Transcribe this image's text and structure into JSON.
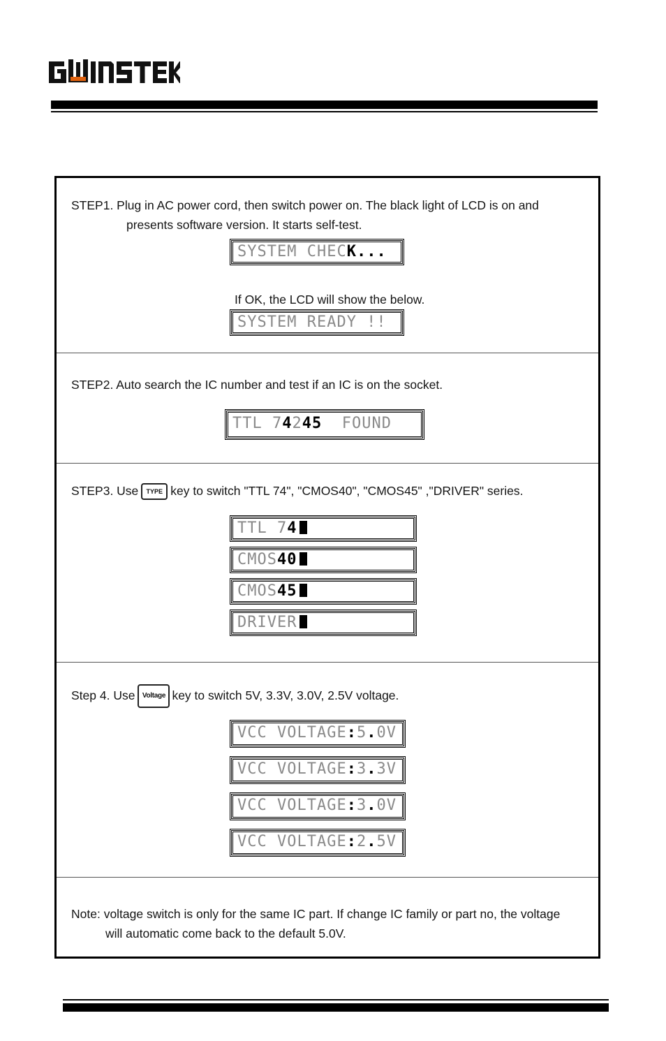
{
  "header": {
    "logo_text": "GWINSTEK",
    "logo_accent_color": "#e0620f"
  },
  "steps": {
    "step1": {
      "line1": "STEP1.  Plug in AC power cord, then switch power on. The black light of LCD is on and",
      "line2": "presents software version.  It starts self-test.",
      "lcd1": {
        "dim": "SYSTEM CHEC",
        "bright": "K..."
      },
      "ok_text": "If OK, the LCD will show the below.",
      "lcd2": {
        "dim": "SYSTEM READY !!"
      }
    },
    "step2": {
      "line1": "STEP2.   Auto search the IC number and test if an IC is on the socket.",
      "lcd": {
        "p1": "TTL 7",
        "p2": "4",
        "p3": "2",
        "p4": "45",
        "p5": "  FOUND"
      }
    },
    "step3": {
      "prefix": "STEP3.  Use",
      "key_label": "TYPE",
      "suffix": "key to switch \"TTL 74\", \"CMOS40\", \"CMOS45\" ,\"DRIVER\" series.",
      "lcds": [
        {
          "dim": "TTL 7",
          "bright": "4"
        },
        {
          "dim": "CMOS",
          "bright": "40"
        },
        {
          "dim": "CMOS",
          "bright": "45"
        },
        {
          "dim": "DRIVER",
          "bright": ""
        }
      ]
    },
    "step4": {
      "prefix": "Step 4. Use",
      "key_label": "Voltage",
      "suffix": "key to switch 5V, 3.3V, 3.0V, 2.5V  voltage.",
      "lcd_label": "VCC VOLTAGE",
      "lcds": [
        {
          "a": "5",
          "b": "0V"
        },
        {
          "a": "3",
          "b": "3V"
        },
        {
          "a": "3",
          "b": "0V"
        },
        {
          "a": "2",
          "b": "5V"
        }
      ]
    },
    "note": {
      "line1": "Note: voltage switch is only for the same IC part. If change IC family or part no, the voltage",
      "line2": "will automatic come back to the default 5.0V."
    }
  }
}
